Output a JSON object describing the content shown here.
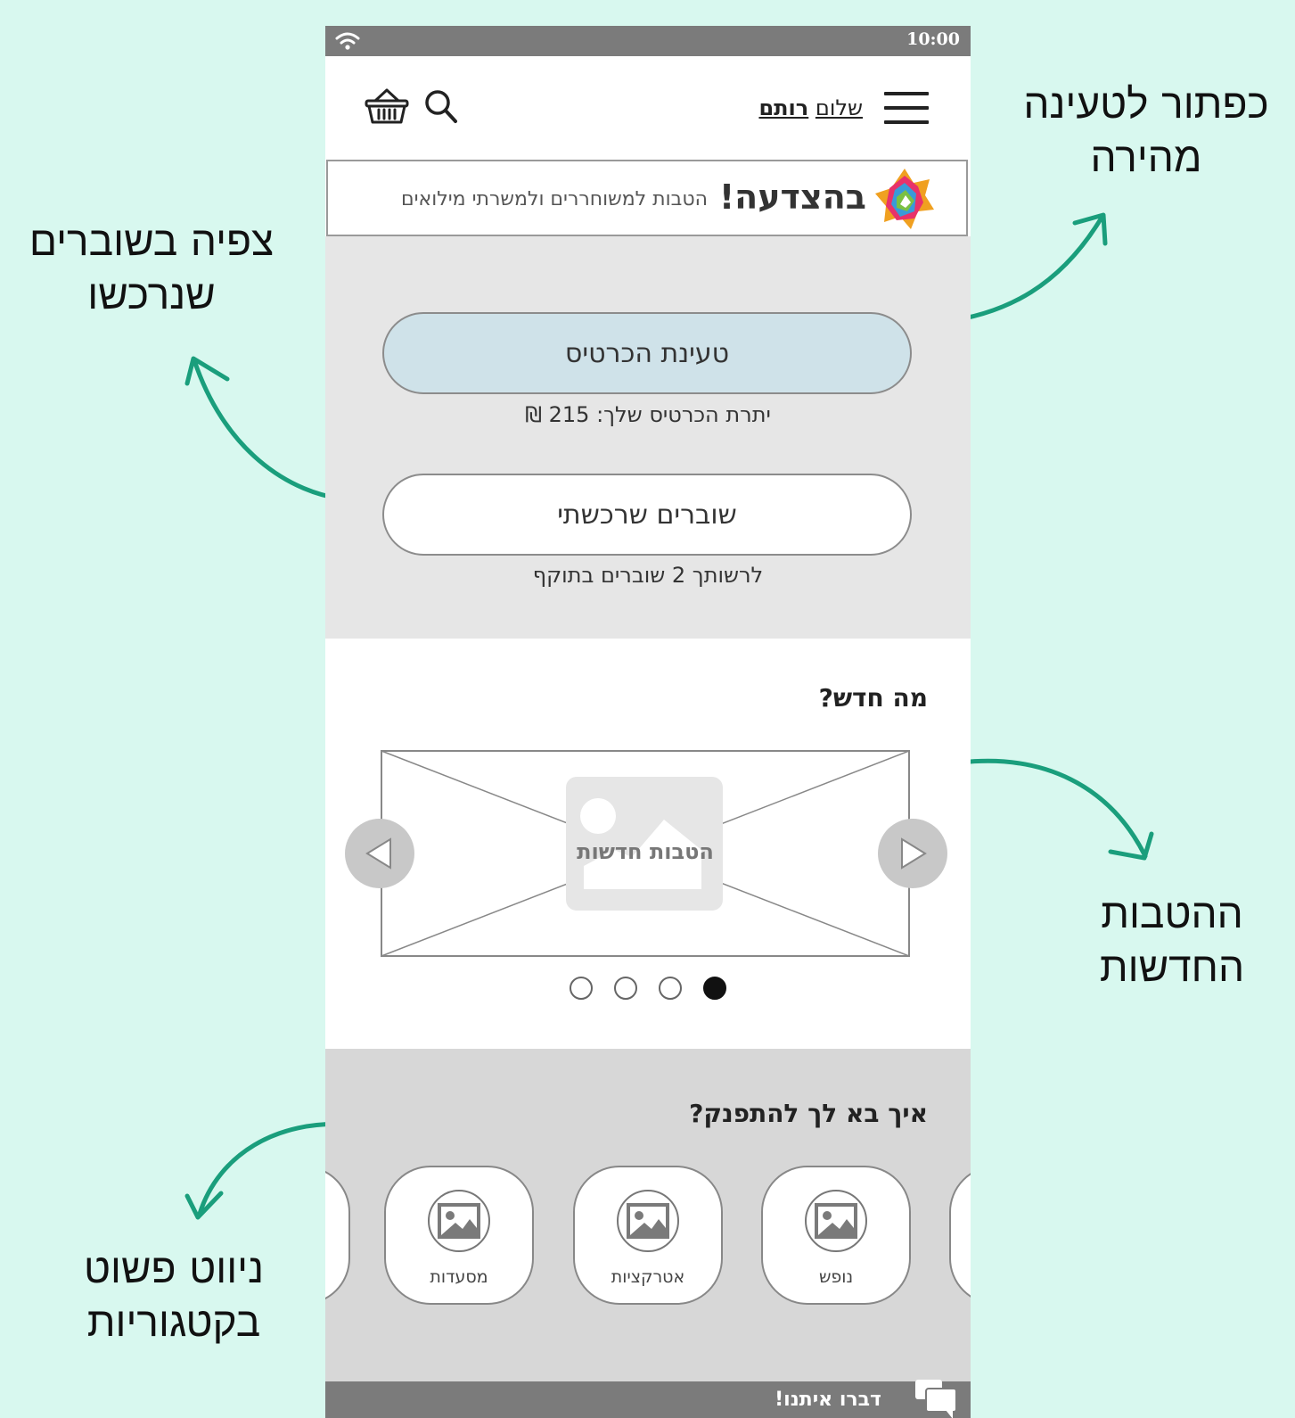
{
  "annotations": {
    "quick_load": [
      "כפתור לטעינה",
      "מהירה"
    ],
    "view_vouchers": [
      "צפיה בשוברים",
      "שנרכשו"
    ],
    "new_benefits": [
      "ההטבות",
      "החדשות"
    ],
    "category_nav": [
      "ניווט פשוט",
      "בקטגוריות"
    ]
  },
  "status_bar": {
    "time": "10:00"
  },
  "header": {
    "greeting_hello": "שלום",
    "greeting_name": "רותם"
  },
  "banner": {
    "title": "בהצדעה!",
    "subtitle": "הטבות למשוחררים ולמשרתי מילואים"
  },
  "card": {
    "load_button": "טעינת הכרטיס",
    "balance_text": "יתרת הכרטיס שלך: 215 ₪",
    "vouchers_button": "שוברים שרכשתי",
    "vouchers_text": "לרשותך 2 שוברים בתוקף"
  },
  "news": {
    "title": "מה חדש?",
    "carousel_label": "הטבות חדשות",
    "slide_count": 4,
    "active_slide": 1
  },
  "categories": {
    "title": "איך בא לך להתפנק?",
    "items": [
      {
        "label": "נופש",
        "icon": "image-icon"
      },
      {
        "label": "אטרקציות",
        "icon": "image-icon"
      },
      {
        "label": "מסעדות",
        "icon": "image-icon"
      }
    ]
  },
  "footer": {
    "contact": "דברו איתנו!"
  },
  "colors": {
    "page_bg": "#d8f8ef",
    "arrow": "#1a9e7c",
    "status_bar": "#7b7b7b",
    "load_button_bg": "#cfe2e9",
    "cards_bg": "#e6e6e6",
    "categories_bg": "#d7d7d7"
  }
}
